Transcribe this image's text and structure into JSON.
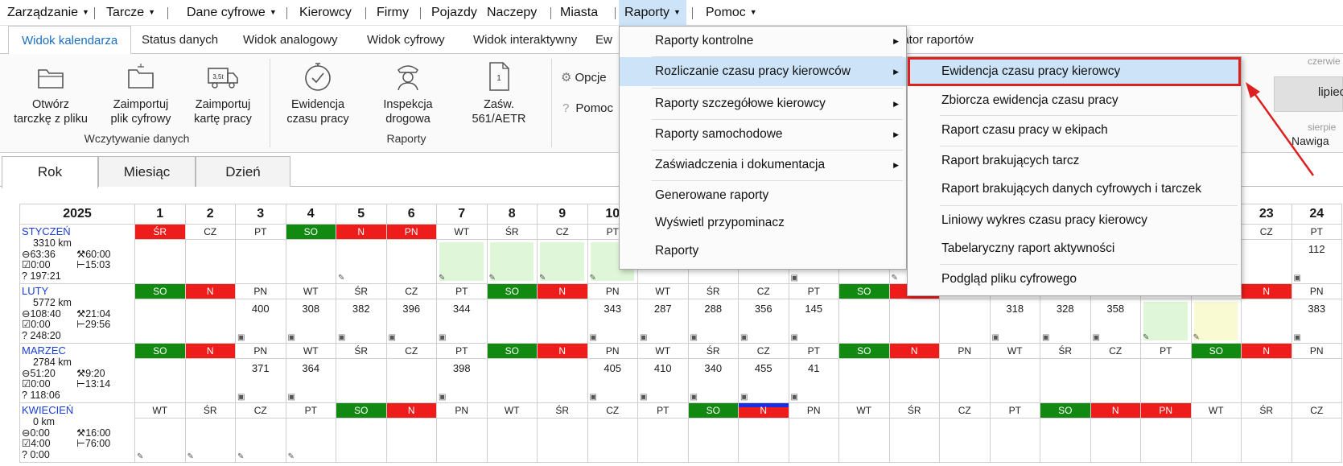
{
  "menubar": {
    "items": [
      "Zarządzanie",
      "Tarcze",
      "Dane cyfrowe",
      "Kierowcy",
      "Firmy",
      "Pojazdy",
      "Naczepy",
      "Miasta",
      "Raporty",
      "Pomoc"
    ]
  },
  "ribbon_tabs": [
    "Widok kalendarza",
    "Status danych",
    "Widok analogowy",
    "Widok cyfrowy",
    "Widok interaktywny",
    "Ew",
    "erator raportów"
  ],
  "ribbon": {
    "btn_open": "Otwórz\ntarczkę z pliku",
    "btn_import_file": "Zaimportuj\nplik cyfrowy",
    "btn_import_card": "Zaimportuj\nkartę pracy",
    "btn_evidence": "Ewidencja\nczasu pracy",
    "btn_inspection": "Inspekcja\ndrogowa",
    "btn_certificate": "Zaśw.\n561/AETR",
    "group_load": "Wczytywanie danych",
    "group_reports": "Raporty",
    "options": "Opcje",
    "help": "Pomoc",
    "truck_badge": "3,5t",
    "doc_badge": "1",
    "right_month_top": "czerwie",
    "right_month": "lipiec",
    "right_month_bottom": "sierpie",
    "nav": "Nawiga"
  },
  "view_tabs": [
    "Rok",
    "Miesiąc",
    "Dzień"
  ],
  "calendar": {
    "year": "2025",
    "days": [
      "1",
      "2",
      "3",
      "4",
      "5",
      "6",
      "7",
      "8",
      "9",
      "10",
      "11",
      "12",
      "13",
      "14",
      "15",
      "16",
      "17",
      "18",
      "19",
      "20",
      "21",
      "22",
      "23",
      "24"
    ],
    "months": [
      {
        "name": "STYCZEŃ",
        "km": "3310 km",
        "t1": "63:36",
        "t2": "60:00",
        "t3": "0:00",
        "t4": "15:03",
        "t5": "197:21",
        "dow": [
          "ŚR",
          "CZ",
          "PT",
          "SO",
          "N",
          "PN",
          "WT",
          "ŚR",
          "CZ",
          "PT",
          "",
          "",
          "",
          "",
          "",
          "",
          "",
          "",
          "",
          "",
          "",
          "",
          "CZ",
          "PT"
        ],
        "dow_color": [
          "red",
          "",
          "",
          "green",
          "red",
          "red",
          "",
          "",
          "",
          "",
          "",
          "",
          "",
          "",
          "",
          "",
          "",
          "",
          "",
          "",
          "",
          "",
          "",
          ""
        ],
        "values": [
          "",
          "",
          "",
          "",
          "",
          "",
          "",
          "",
          "",
          "",
          "",
          "",
          "",
          "",
          "",
          "",
          "",
          "",
          "",
          "",
          "",
          "",
          "",
          "112"
        ],
        "fill": [
          "",
          "",
          "",
          "",
          "",
          "",
          "lg",
          "lg",
          "lg",
          "lg",
          "",
          "",
          "",
          "",
          "",
          "",
          "",
          "",
          "",
          "",
          "",
          "",
          "",
          ""
        ],
        "icons": [
          "",
          "",
          "",
          "",
          "p",
          "",
          "p",
          "p",
          "p",
          "p",
          "",
          "",
          "",
          "b",
          "",
          "p",
          "ps",
          "",
          "",
          "",
          "",
          "",
          "",
          "b"
        ]
      },
      {
        "name": "LUTY",
        "km": "5772 km",
        "t1": "108:40",
        "t2": "21:04",
        "t3": "0:00",
        "t4": "29:56",
        "t5": "248:20",
        "dow": [
          "SO",
          "N",
          "PN",
          "WT",
          "ŚR",
          "CZ",
          "PT",
          "SO",
          "N",
          "PN",
          "WT",
          "ŚR",
          "CZ",
          "PT",
          "SO",
          "N",
          "",
          "",
          "",
          "",
          "",
          "",
          "N",
          "PN"
        ],
        "dow_color": [
          "green",
          "red",
          "",
          "",
          "",
          "",
          "",
          "green",
          "red",
          "",
          "",
          "",
          "",
          "",
          "green",
          "red",
          "",
          "",
          "",
          "",
          "",
          "",
          "red",
          ""
        ],
        "values": [
          "",
          "",
          "400",
          "308",
          "382",
          "396",
          "344",
          "",
          "",
          "343",
          "287",
          "288",
          "356",
          "145",
          "",
          "",
          "",
          "318",
          "328",
          "358",
          "",
          "",
          "",
          "383"
        ],
        "fill": [
          "",
          "",
          "",
          "",
          "",
          "",
          "",
          "",
          "",
          "",
          "",
          "",
          "",
          "",
          "",
          "",
          "",
          "",
          "",
          "",
          "lg",
          "ly",
          "",
          ""
        ],
        "icons": [
          "",
          "",
          "b",
          "b",
          "b",
          "b",
          "b",
          "",
          "",
          "b",
          "b",
          "b",
          "b",
          "b",
          "",
          "",
          "",
          "b",
          "b",
          "b",
          "p",
          "p",
          "",
          "b"
        ]
      },
      {
        "name": "MARZEC",
        "km": "2784 km",
        "t1": "51:20",
        "t2": "9:20",
        "t3": "0:00",
        "t4": "13:14",
        "t5": "118:06",
        "dow": [
          "SO",
          "N",
          "PN",
          "WT",
          "ŚR",
          "CZ",
          "PT",
          "SO",
          "N",
          "PN",
          "WT",
          "ŚR",
          "CZ",
          "PT",
          "SO",
          "N",
          "PN",
          "WT",
          "ŚR",
          "CZ",
          "PT",
          "SO",
          "N",
          "PN"
        ],
        "dow_color": [
          "green",
          "red",
          "",
          "",
          "",
          "",
          "",
          "green",
          "red",
          "",
          "",
          "",
          "",
          "",
          "green",
          "red",
          "",
          "",
          "",
          "",
          "",
          "green",
          "red",
          ""
        ],
        "values": [
          "",
          "",
          "371",
          "364",
          "",
          "",
          "398",
          "",
          "",
          "405",
          "410",
          "340",
          "455",
          "41",
          "",
          "",
          "",
          "",
          "",
          "",
          "",
          "",
          "",
          ""
        ],
        "fill": [
          "",
          "",
          "",
          "",
          "",
          "",
          "",
          "",
          "",
          "",
          "",
          "",
          "",
          "",
          "",
          "",
          "",
          "",
          "",
          "",
          "",
          "",
          "",
          ""
        ],
        "icons": [
          "",
          "",
          "b",
          "b",
          "",
          "",
          "b",
          "",
          "",
          "b",
          "b",
          "b",
          "b",
          "b",
          "",
          "",
          "",
          "",
          "",
          "",
          "",
          "",
          "",
          ""
        ]
      },
      {
        "name": "KWIECIEŃ",
        "km": "0 km",
        "t1": "0:00",
        "t2": "16:00",
        "t3": "4:00",
        "t4": "76:00",
        "t5": "0:00",
        "dow": [
          "WT",
          "ŚR",
          "CZ",
          "PT",
          "SO",
          "N",
          "PN",
          "WT",
          "ŚR",
          "CZ",
          "PT",
          "SO",
          "N",
          "PN",
          "WT",
          "ŚR",
          "CZ",
          "PT",
          "SO",
          "N",
          "PN",
          "WT",
          "ŚR",
          "CZ"
        ],
        "dow_color": [
          "",
          "",
          "",
          "",
          "green",
          "red",
          "",
          "",
          "",
          "",
          "",
          "green",
          "flag",
          "",
          "",
          "",
          "",
          "",
          "green",
          "red",
          "red",
          "",
          "",
          ""
        ],
        "values": [
          "",
          "",
          "",
          "",
          "",
          "",
          "",
          "",
          "",
          "",
          "",
          "",
          "",
          "",
          "",
          "",
          "",
          "",
          "",
          "",
          "",
          "",
          "",
          ""
        ],
        "fill": [
          "",
          "",
          "",
          "",
          "",
          "",
          "",
          "",
          "",
          "",
          "",
          "",
          "",
          "",
          "",
          "",
          "",
          "",
          "",
          "",
          "",
          "",
          "",
          ""
        ],
        "icons": [
          "p",
          "p",
          "p",
          "p",
          "",
          "",
          "",
          "",
          "",
          "",
          "",
          "",
          "",
          "",
          "",
          "",
          "",
          "",
          "",
          "",
          "",
          "",
          "",
          ""
        ]
      }
    ]
  },
  "menu_raporty": {
    "items": [
      "Raporty kontrolne",
      "Rozliczanie czasu pracy kierowców",
      "Raporty szczegółowe kierowcy",
      "Raporty samochodowe",
      "Zaświadczenia i dokumentacja",
      "Generowane raporty",
      "Wyświetl przypominacz",
      "Raporty"
    ]
  },
  "submenu_rozliczanie": {
    "items": [
      "Ewidencja czasu pracy kierowcy",
      "Zbiorcza ewidencja czasu pracy",
      "Raport czasu pracy w ekipach",
      "Raport brakujących tarcz",
      "Raport brakujących danych cyfrowych i tarczek",
      "Liniowy wykres czasu pracy kierowcy",
      "Tabelaryczny raport aktywności",
      "Podgląd pliku cyfrowego"
    ]
  },
  "colors": {
    "accent": "#1b6ec2",
    "highlight": "#cde3f7",
    "annotation": "#dd2020",
    "weekend_green": "#128a12",
    "holiday_red": "#ef1c1c"
  }
}
